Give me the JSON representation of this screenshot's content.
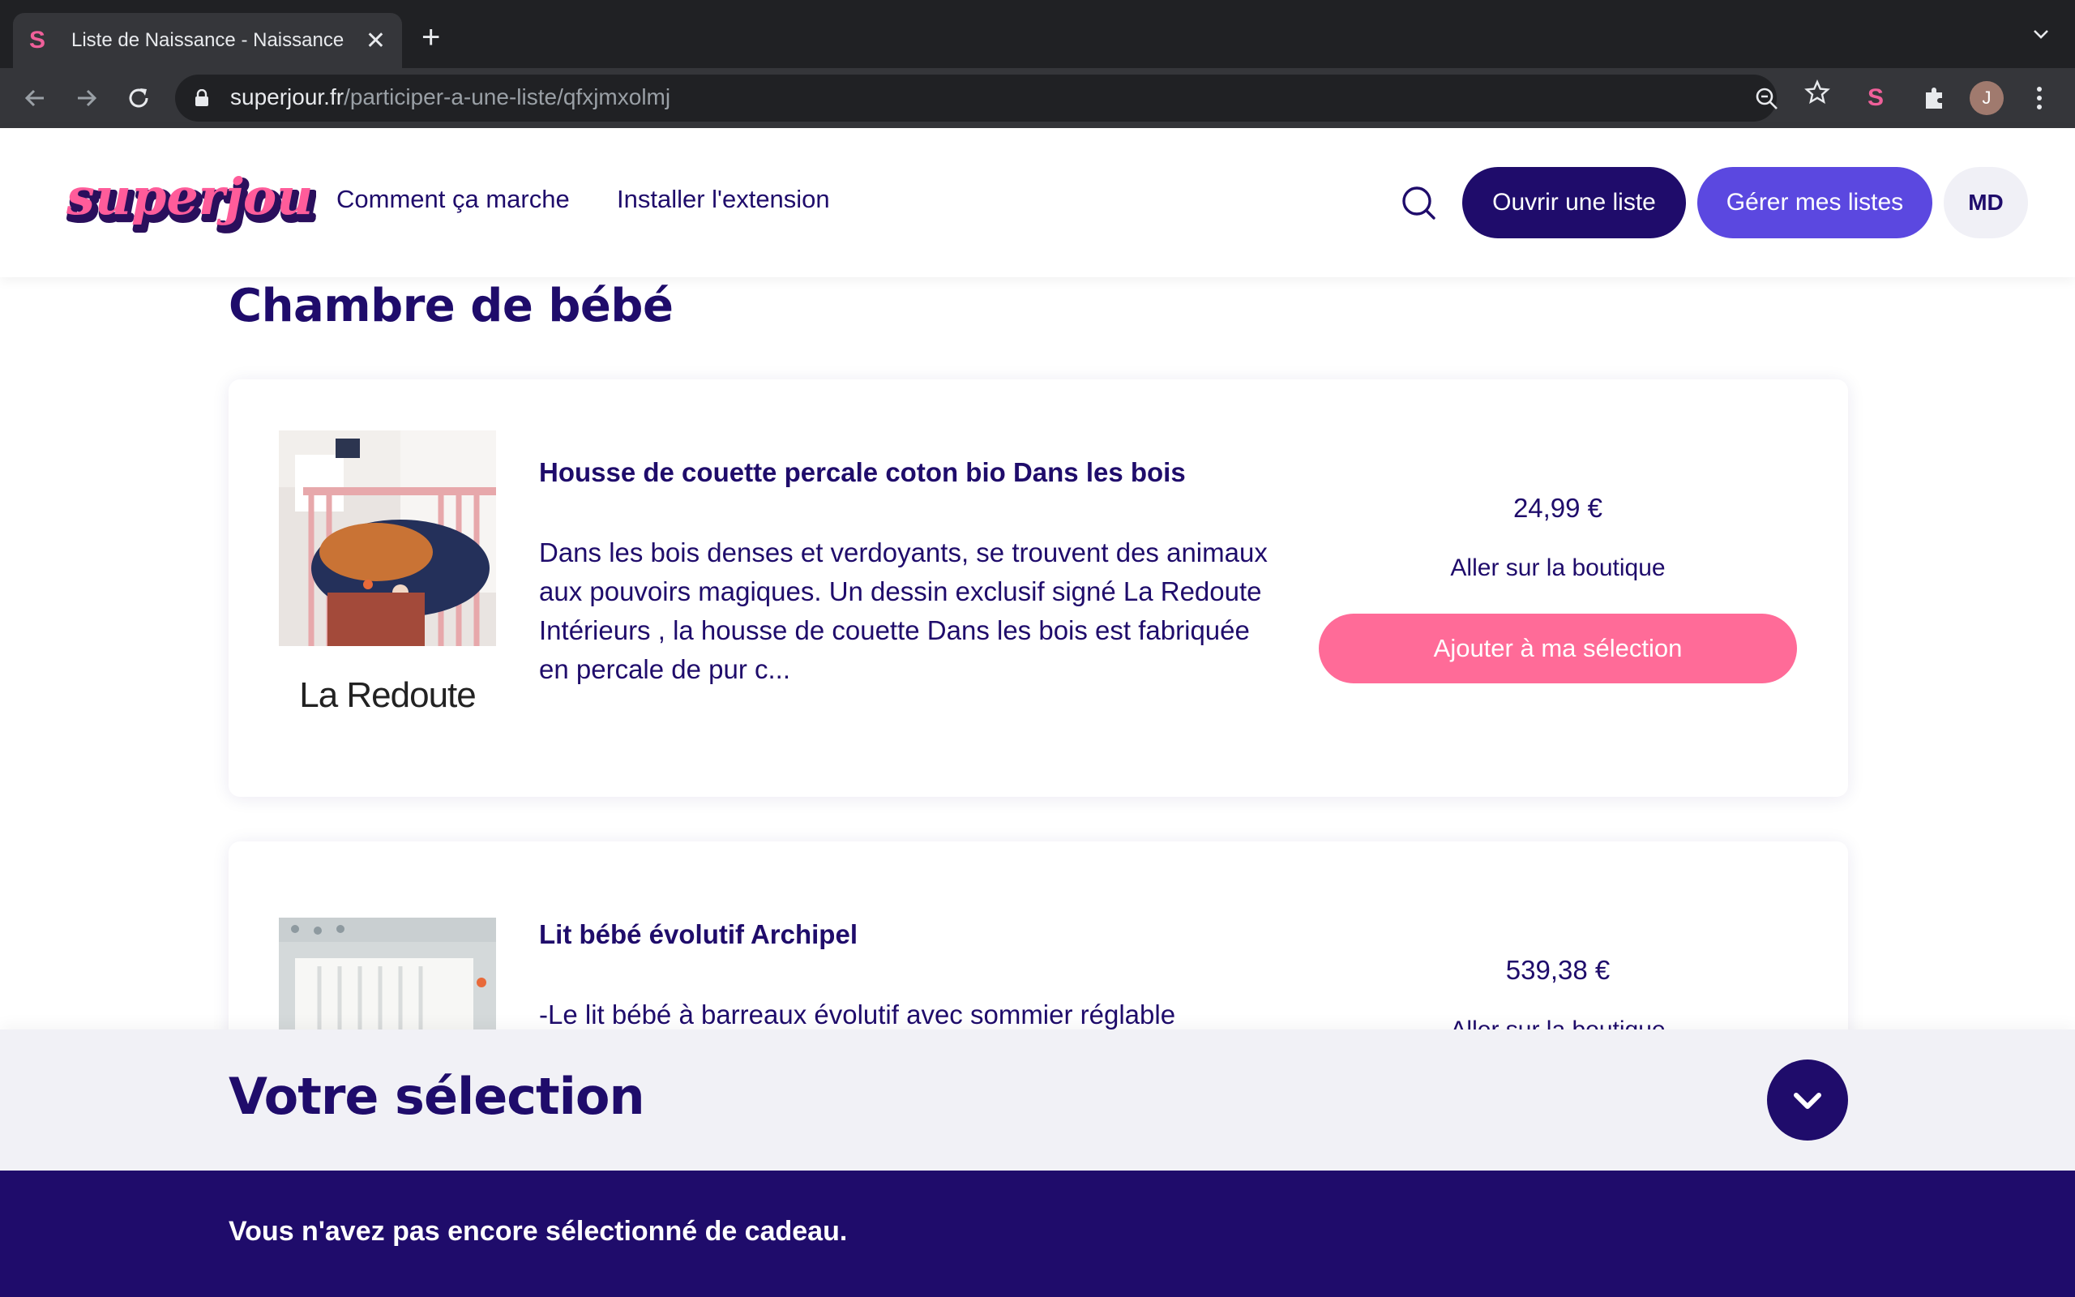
{
  "browser": {
    "tab_title": "Liste de Naissance - Naissance",
    "tab_close": "✕",
    "new_tab": "+",
    "url_host": "superjour.fr",
    "url_path": "/participer-a-une-liste/qfxjmxolmj",
    "profile_initial": "J",
    "favicon_letter": "S"
  },
  "header": {
    "logo_text": "superjour",
    "nav": [
      "Comment ça marche",
      "Installer l'extension"
    ],
    "open_list": "Ouvrir une liste",
    "manage_lists": "Gérer mes listes",
    "user_initials": "MD"
  },
  "section": {
    "title": "Chambre de bébé"
  },
  "products": [
    {
      "title": "Housse de couette percale coton bio Dans les bois",
      "description": "Dans les bois denses et verdoyants, se trouvent des animaux aux pouvoirs magiques. Un dessin exclusif signé La Redoute Intérieurs , la housse de couette Dans les bois est fabriquée en percale de pur c...",
      "brand": "La Redoute",
      "price": "24,99 €",
      "shop_link": "Aller sur la boutique",
      "add_button": "Ajouter à ma sélection"
    },
    {
      "title": "Lit bébé évolutif Archipel",
      "description": "-Le lit bébé à barreaux évolutif avec sommier réglable",
      "price": "539,38 €",
      "shop_link": "Aller sur la boutique"
    }
  ],
  "selection": {
    "title": "Votre sélection",
    "empty_message": "Vous n'avez pas encore sélectionné de cadeau."
  },
  "colors": {
    "brand_dark": "#1f0c6b",
    "brand_purple": "#5b48e0",
    "brand_pink": "#ff6b98"
  }
}
